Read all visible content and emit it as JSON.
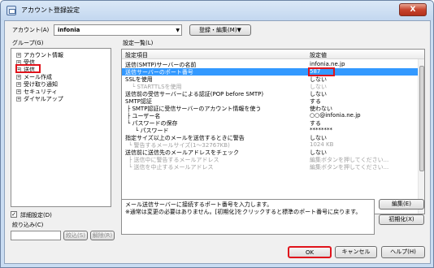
{
  "window": {
    "title": "アカウント登録設定",
    "close_glyph": "X"
  },
  "account": {
    "label": "アカウント(A)",
    "value": "infonia",
    "register_edit": "登録・編集(M)▼"
  },
  "group": {
    "label": "グループ(G)",
    "items": [
      {
        "label": "アカウント情報",
        "expander": "+"
      },
      {
        "label": "受信",
        "expander": "+"
      },
      {
        "label": "送信",
        "expander": "+"
      },
      {
        "label": "メール作成",
        "expander": "+"
      },
      {
        "label": "受け取り通知",
        "expander": "+"
      },
      {
        "label": "セキュリティ",
        "expander": "+"
      },
      {
        "label": "ダイヤルアップ",
        "expander": "+"
      }
    ],
    "detail_checkbox": {
      "label": "詳細設定(D)",
      "checked": "✓"
    },
    "filter_label": "絞り込み(C)",
    "filter_button": "絞込(S)",
    "clear_button": "解除(R)"
  },
  "settings": {
    "label": "設定一覧(L)",
    "header": {
      "item": "設定項目",
      "value": "設定値"
    },
    "rows": [
      {
        "item": "送信(SMTP)サーバーの名前",
        "value": "infonia.ne.jp"
      },
      {
        "item": "送信サーバーのポート番号",
        "value": "587"
      },
      {
        "item": "SSLを使用",
        "value": "しない"
      },
      {
        "item": "└ STARTTLSを使用",
        "value": "しない"
      },
      {
        "item": "送信前の受信サーバーによる認証(POP before SMTP)",
        "value": "しない"
      },
      {
        "item": "SMTP認証",
        "value": "する"
      },
      {
        "item": "├ SMTP認証に受信サーバーのアカウント情報を使う",
        "value": "使わない"
      },
      {
        "item": "├ ユーザー名",
        "value": "○○@infonia.ne.jp"
      },
      {
        "item": "└ パスワードの保存",
        "value": "する"
      },
      {
        "item": "└ パスワード",
        "value": "********"
      },
      {
        "item": "指定サイズ以上のメールを送信するときに警告",
        "value": "しない"
      },
      {
        "item": "└ 警告するメールサイズ(1～32767KB)",
        "value": "1024 KB"
      },
      {
        "item": "送信前に送信先のメールアドレスをチェック",
        "value": "しない"
      },
      {
        "item": "├ 送信中に警告するメールアドレス",
        "value": "編集ボタンを押してください..."
      },
      {
        "item": "└ 送信を中止するメールアドレス",
        "value": "編集ボタンを押してください..."
      }
    ],
    "description": "メール送信サーバーに接続するポート番号を入力します。\n※通常は変更の必要はありません。[初期化]をクリックすると標準のポート番号に戻ります。",
    "edit_button": "編集(E)",
    "init_button": "初期化(X)"
  },
  "footer": {
    "ok": "OK",
    "cancel": "キャンセル",
    "help": "ヘルプ(H)"
  },
  "colors": {
    "highlight": "#3399ff",
    "annotation": "#e0141c"
  }
}
